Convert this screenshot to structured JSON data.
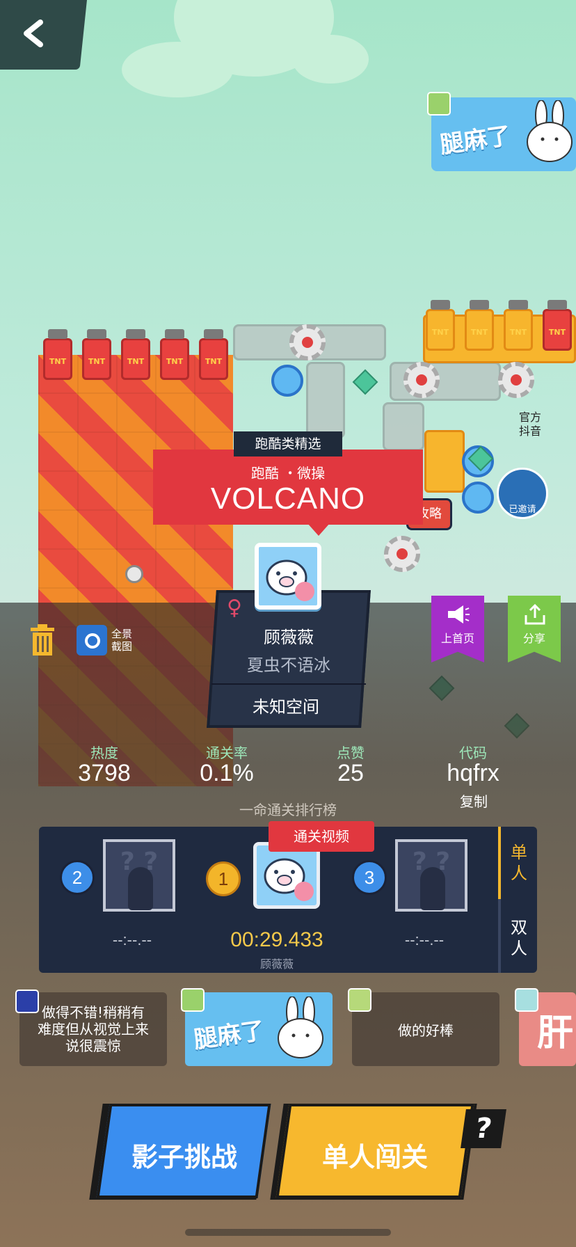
{
  "sticker_top": {
    "text": "腿麻了"
  },
  "side_badges": {
    "douyin": "官方\n抖音",
    "invited": "已邀请"
  },
  "guide_badge": "攻略",
  "banner": {
    "category_tag": "跑酷类精选",
    "tags": "跑酷 ・微操",
    "title": "VOLCANO"
  },
  "author": {
    "gender_symbol": "♀",
    "name": "顾薇薇",
    "subtitle": "夏虫不语冰",
    "world": "未知空间"
  },
  "tools": {
    "screenshot_label": "全景截图"
  },
  "flags": {
    "home_label": "上首页",
    "share_label": "分享"
  },
  "stats": {
    "heat_label": "热度",
    "heat_value": "3798",
    "clear_rate_label": "通关率",
    "clear_rate_value": "0.1%",
    "likes_label": "点赞",
    "likes_value": "25",
    "code_label": "代码",
    "code_value": "hqfrx",
    "copy_label": "复制"
  },
  "leaderboard": {
    "title": "一命通关排行榜",
    "video_label": "通关视频",
    "tab_single": "单人",
    "tab_double": "双人",
    "ranks": [
      {
        "rank": "2",
        "time": "--:--.--"
      },
      {
        "rank": "1",
        "time": "00:29.433",
        "name": "顾薇薇"
      },
      {
        "rank": "3",
        "time": "--:--.--"
      }
    ]
  },
  "comments": [
    {
      "text": "做得不错!稍稍有难度但从视觉上来说很震惊"
    },
    {
      "text": "腿麻了"
    },
    {
      "text": "做的好棒"
    },
    {
      "text": "肝"
    }
  ],
  "buttons": {
    "shadow_challenge": "影子挑战",
    "single_play": "单人闯关",
    "help": "?"
  },
  "colors": {
    "accent_red": "#e1373f",
    "accent_yellow": "#f7b82e",
    "accent_blue": "#3a8ef0",
    "panel_dark": "#1f2a40",
    "stat_green": "#9de6b8"
  }
}
